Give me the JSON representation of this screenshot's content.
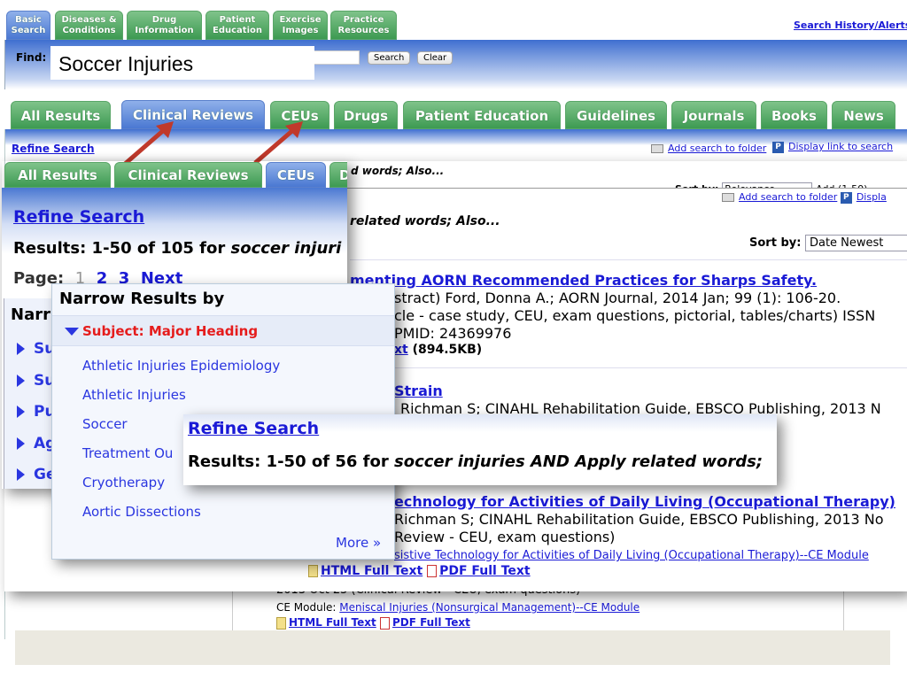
{
  "top": {
    "tabs": [
      "Basic Search",
      "Diseases & Conditions",
      "Drug Information",
      "Patient Education",
      "Exercise Images",
      "Practice Resources"
    ],
    "search_history": "Search History/Alerts",
    "find_label": "Find:",
    "find_value": "Soccer Injuries",
    "search_button": "Search",
    "clear_button": "Clear"
  },
  "layer_a": {
    "tabs": [
      "All Results",
      "Clinical Reviews",
      "CEUs",
      "Drugs",
      "Patient Education",
      "Guidelines",
      "Journals",
      "Books",
      "News"
    ],
    "refine": "Refine Search",
    "add_folder": "Add search to folder",
    "display_link": "Display link to search",
    "also": "d words; Also...",
    "sort_label": "Sort by:",
    "sort_value": "Relevance",
    "add_range": "Add (1-50)",
    "line1": "2013 Oct 25 (Clinical Review - CEU, exam questions)",
    "ce_label": "CE Module:",
    "ce_link": "Meniscal Injuries (Nonsurgical Management)--CE Module",
    "html": "HTML Full Text",
    "pdf": "PDF Full Text"
  },
  "layer_b": {
    "tabs": [
      "All Results",
      "Clinical Reviews",
      "CEUs",
      "D"
    ],
    "refine": "Refine Search",
    "results": "Results: 1-50 of 105 for ",
    "results_q": "soccer injuri",
    "page_label": "Page:",
    "pages": [
      "1",
      "2",
      "3",
      "Next"
    ],
    "narrow": "Narr",
    "side_items": [
      "Su",
      "Su",
      "Pu",
      "Ag",
      "Ge"
    ],
    "add_folder": "Add search to folder",
    "display_link": "Displa",
    "also": "related words; Also...",
    "sort_label": "Sort by:",
    "sort_value": "Date Newest",
    "r1": {
      "title": "menting AORN Recommended Practices for Sharps Safety.",
      "l1": "stract) Ford, Donna A.; AORN Journal, 2014 Jan; 99 (1): 106-20.",
      "l2": "cle - case study, CEU, exam questions, pictorial, tables/charts) ISSN",
      "l3": "PMID: 24369976",
      "link": "xt",
      "size": "(894.5KB)"
    },
    "r2": {
      "title": "Strain",
      "l1": "Richman S; CINAHL Rehabilitation Guide, EBSCO Publishing, 2013 N"
    },
    "r3": {
      "title": "echnology for Activities of Daily Living (Occupational Therapy)",
      "l1": "Richman S; CINAHL Rehabilitation Guide, EBSCO Publishing, 2013 No",
      "l2": "Review - CEU, exam questions)",
      "link": "sistive Technology for Activities of Daily Living (Occupational Therapy)--CE Module",
      "html": "HTML Full Text",
      "pdf": "PDF Full Text"
    }
  },
  "narrow_popup": {
    "title": "Narrow Results by",
    "heading": "Subject: Major Heading",
    "items": [
      "Athletic Injuries Epidemiology",
      "Athletic Injuries",
      "Soccer",
      "Treatment Ou",
      "Cryotherapy",
      "Aortic Dissections"
    ],
    "more": "More »"
  },
  "refine_popup": {
    "refine": "Refine Search",
    "results": "Results: 1-50 of 56 for ",
    "query": "soccer injuries AND Apply related words;"
  },
  "colors": {
    "tab_green": "#4ea561",
    "tab_blue": "#5a84d8",
    "link": "#1a1ad6",
    "heading_red": "#e51c1c",
    "arrow": "#c0392b"
  }
}
